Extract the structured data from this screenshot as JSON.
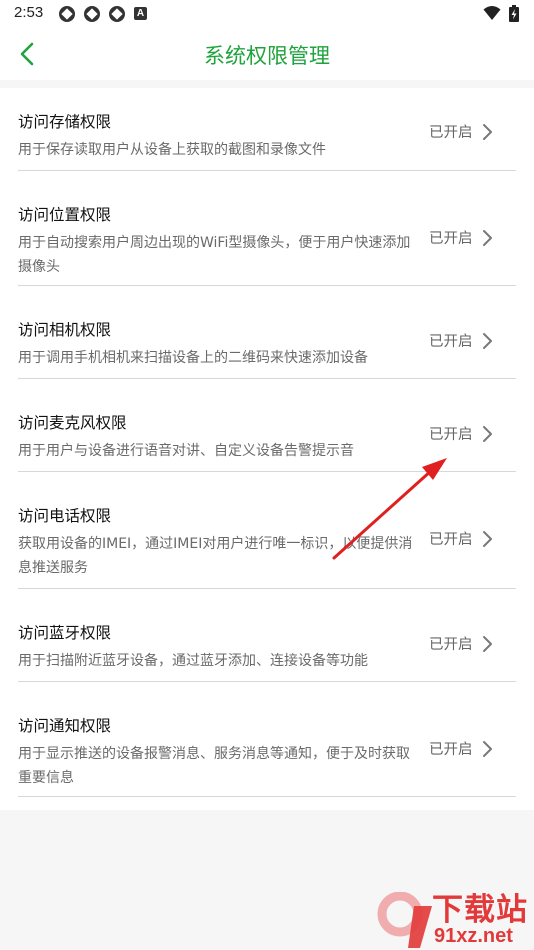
{
  "status_bar": {
    "time": "2:53",
    "icons": [
      "notification-icon",
      "notification-icon",
      "notification-icon",
      "a-icon",
      "wifi-icon",
      "battery-charging-icon"
    ],
    "a_icon_text": "A"
  },
  "header": {
    "title": "系统权限管理",
    "back_icon": "chevron-left-icon"
  },
  "colors": {
    "accent": "#1fa33c",
    "annotation": "#e02020",
    "watermark": "#e23a3a"
  },
  "permissions": [
    {
      "title": "访问存储权限",
      "description": "用于保存读取用户从设备上获取的截图和录像文件",
      "status": "已开启"
    },
    {
      "title": "访问位置权限",
      "description": "用于自动搜索用户周边出现的WiFi型摄像头，便于用户快速添加摄像头",
      "status": "已开启"
    },
    {
      "title": "访问相机权限",
      "description": "用于调用手机相机来扫描设备上的二维码来快速添加设备",
      "status": "已开启"
    },
    {
      "title": "访问麦克风权限",
      "description": "用于用户与设备进行语音对讲、自定义设备告警提示音",
      "status": "已开启"
    },
    {
      "title": "访问电话权限",
      "description": "获取用设备的IMEI，通过IMEI对用户进行唯一标识，以便提供消息推送服务",
      "status": "已开启"
    },
    {
      "title": "访问蓝牙权限",
      "description": "用于扫描附近蓝牙设备，通过蓝牙添加、连接设备等功能",
      "status": "已开启"
    },
    {
      "title": "访问通知权限",
      "description": "用于显示推送的设备报警消息、服务消息等通知，便于及时获取重要信息",
      "status": "已开启"
    }
  ],
  "watermark": {
    "text": "下载站",
    "url": "91xz.net"
  }
}
